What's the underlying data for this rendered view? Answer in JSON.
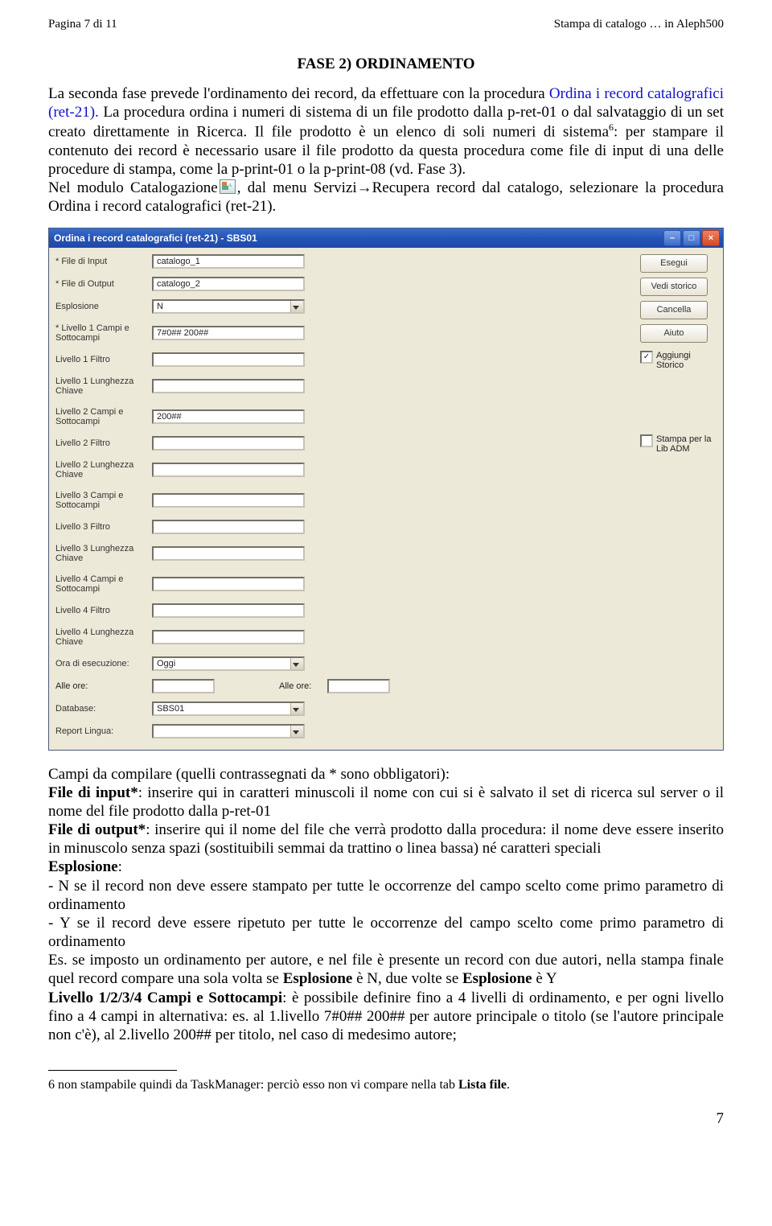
{
  "header": {
    "left": "Pagina 7 di 11",
    "right": "Stampa di catalogo … in Aleph500"
  },
  "section_title": "FASE 2) ORDINAMENTO",
  "body1_a": "La seconda fase prevede l'ordinamento dei record, da effettuare con la procedura ",
  "body1_b": "Ordina i record catalografici (ret-21).",
  "body2": "La procedura ordina i numeri di sistema di un file prodotto dalla p-ret-01 o dal salvataggio di un set creato direttamente in Ricerca. Il file prodotto è un elenco di soli numeri di sistema",
  "body2_sup": "6",
  "body2_cont": ": per stampare il contenuto dei record è necessario usare il file prodotto da questa procedura come file di input di una delle procedure di stampa, come la p-print-01 o la p-print-08 (vd. Fase 3).",
  "body3_a": "Nel modulo Catalogazione",
  "body3_b": ", dal menu Servizi→Recupera record dal catalogo, selezionare la procedura Ordina i record catalografici (ret-21).",
  "dialog": {
    "title": "Ordina i record catalografici (ret-21) - SBS01",
    "labels": {
      "file_input": "* File di Input",
      "file_output": "* File di Output",
      "esplosione": "Esplosione",
      "l1campi": "* Livello 1 Campi e Sottocampi",
      "l1filtro": "Livello 1 Filtro",
      "l1lung": "Livello 1 Lunghezza Chiave",
      "l2campi": "Livello 2 Campi e Sottocampi",
      "l2filtro": "Livello 2 Filtro",
      "l2lung": "Livello 2 Lunghezza Chiave",
      "l3campi": "Livello 3 Campi e Sottocampi",
      "l3filtro": "Livello 3 Filtro",
      "l3lung": "Livello 3 Lunghezza Chiave",
      "l4campi": "Livello 4 Campi e Sottocampi",
      "l4filtro": "Livello 4 Filtro",
      "l4lung": "Livello 4 Lunghezza Chiave",
      "ora": "Ora di esecuzione:",
      "alle1": "Alle ore:",
      "alle2": "Alle ore:",
      "database": "Database:",
      "replin": "Report Lingua:"
    },
    "values": {
      "file_input": "catalogo_1",
      "file_output": "catalogo_2",
      "esplosione": "N",
      "l1campi": "7#0## 200##",
      "l2campi": "200##",
      "ora": "Oggi",
      "database": "SBS01"
    },
    "buttons": {
      "esegui": "Esegui",
      "storico": "Vedi storico",
      "cancella": "Cancella",
      "aiuto": "Aiuto"
    },
    "checks": {
      "aggiungi": "Aggiungi Storico",
      "stampa": "Stampa per la Lib ADM"
    }
  },
  "para2": {
    "l1": "Campi da compilare (quelli contrassegnati da * sono obbligatori):",
    "l2_a": "File di input*",
    "l2_b": ": inserire qui in caratteri minuscoli il nome con cui si è salvato il set di ricerca sul server o il nome del file prodotto dalla p-ret-01",
    "l3_a": "File di output*",
    "l3_b": ": inserire qui il nome del file che verrà prodotto dalla procedura: il nome deve essere inserito in minuscolo senza spazi (sostituibili semmai da trattino o linea bassa) né caratteri speciali",
    "l4_a": "Esplosione",
    "l4_b": ":",
    "l5": "- N se il record non deve essere stampato per tutte le occorrenze del campo scelto come primo parametro di ordinamento",
    "l6": "- Y se il record deve essere ripetuto per tutte le occorrenze del campo scelto come primo parametro di ordinamento",
    "l7_a": "Es. se imposto un ordinamento per autore, e nel file è presente un record con due autori, nella stampa finale quel record compare una sola volta se ",
    "l7_b": "Esplosione",
    "l7_c": " è N, due volte se ",
    "l7_d": "Esplosione",
    "l7_e": " è Y",
    "l8_a": "Livello 1/2/3/4 Campi e Sottocampi",
    "l8_b": ": è possibile definire fino a 4 livelli di ordinamento, e per ogni livello fino a 4 campi in alternativa: es. al 1.livello 7#0## 200## per autore principale o titolo (se l'autore principale non c'è), al 2.livello 200## per titolo, nel caso di medesimo autore;"
  },
  "footnote": {
    "num": "6",
    "text": " non stampabile quindi da TaskManager: perciò esso non vi compare nella tab ",
    "bold": "Lista file",
    "end": "."
  },
  "pagenum": "7"
}
